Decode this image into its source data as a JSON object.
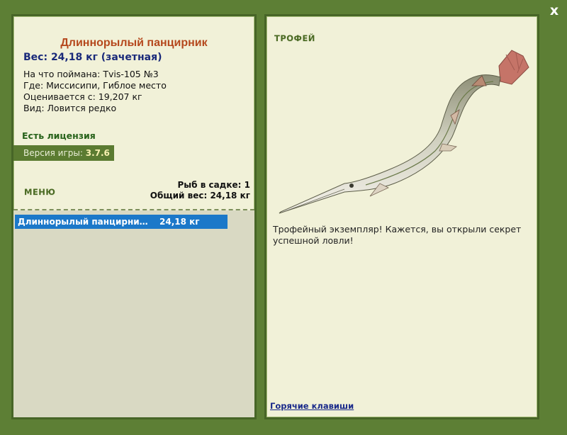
{
  "window": {
    "close_label": "x"
  },
  "fish": {
    "name": "Длиннорылый панцирник",
    "weight_line": "Вес: 24,18 кг (зачетная)",
    "caught_with": "На что поймана: Tvis-105 №3",
    "location": "Где: Миссисипи, Гиблое место",
    "rated_from": "Оценивается с: 19,207 кг",
    "rarity": "Вид: Ловится редко"
  },
  "license": "Есть лицензия",
  "version": {
    "label": "Версия игры:",
    "value": "3.7.6"
  },
  "menu_label": "МЕНЮ",
  "cage": {
    "count_line": "Рыб в садке: 1",
    "total_line": "Общий вес: 24,18 кг"
  },
  "catch_list": [
    {
      "name": "Длиннорылый панцирни…",
      "weight": "24,18 кг"
    }
  ],
  "trophy": {
    "label": "ТРОФЕЙ",
    "text": "Трофейный экземпляр! Кажется, вы открыли секрет успешной ловли!",
    "image_icon": "longnose-gar-fish"
  },
  "hotkeys_link": "Горячие клавиши",
  "colors": {
    "background": "#5d7f35",
    "panel": "#f1f1d8",
    "title": "#b5481d",
    "weight": "#1a2a7a",
    "license": "#27621a",
    "selection": "#1b78c9",
    "link": "#1a2a8a"
  }
}
